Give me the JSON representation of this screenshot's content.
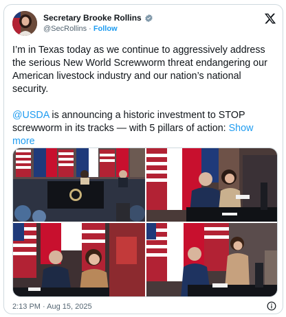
{
  "author": {
    "display_name": "Secretary Brooke Rollins",
    "handle": "@SecRollins",
    "separator": "·",
    "follow_label": "Follow"
  },
  "tweet": {
    "paragraph_1": "I’m in Texas today as we continue to aggressively address the serious New World Screwworm threat endangering our American livestock industry and our nation’s national security.",
    "mention": "@USDA",
    "paragraph_2_rest": " is announcing a historic investment to STOP screwworm in its tracks — with 5 pillars of action: ",
    "show_more": "Show more"
  },
  "footer": {
    "timestamp": "2:13 PM · Aug 15, 2025"
  },
  "icons": {
    "verified": "verified-badge-icon",
    "x_logo": "x-logo-icon",
    "info": "info-icon"
  },
  "colors": {
    "link": "#1d9bf0",
    "text": "#0f1419",
    "muted": "#536471",
    "border": "#cfd9de"
  }
}
